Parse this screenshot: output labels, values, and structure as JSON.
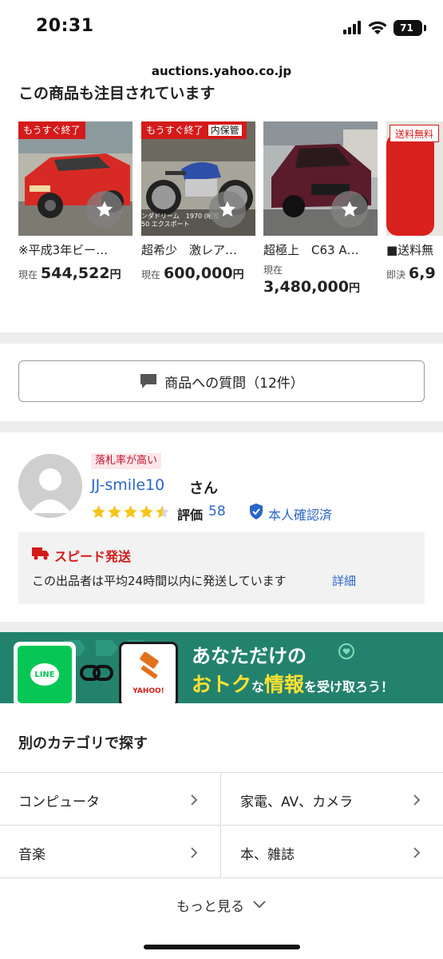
{
  "status_bar": {
    "time": "20:31",
    "battery": "71"
  },
  "url": "auctions.yahoo.co.jp",
  "related": {
    "heading": "この商品も注目されています",
    "items": [
      {
        "badge": "もうすぐ終了",
        "title": "※平成3年ビー…",
        "price_label": "現在",
        "price": "544,522",
        "unit": "円"
      },
      {
        "badge": "もうすぐ終了",
        "badge_overflow": "内保管",
        "overlay_text": "ンダドリーム　1970 (昭和\n50 エクスポート",
        "title": "超希少　激レア…",
        "price_label": "現在",
        "price": "600,000",
        "unit": "円"
      },
      {
        "title": "超極上　C63 A…",
        "price_label": "現在",
        "price": "3,480,000",
        "unit": "円"
      },
      {
        "badge": "送料無料",
        "title": "■送料無",
        "price_label": "即決",
        "price": "6,9"
      }
    ]
  },
  "question_button": {
    "label": "商品への質問（12件）"
  },
  "seller": {
    "tag": "落札率が高い",
    "name": "JJ-smile10",
    "honorific": "さん",
    "stars": 4.5,
    "rating_label": "評価",
    "rating_value": "58",
    "verified": "本人確認済",
    "shipping_title": "スピード発送",
    "shipping_desc": "この出品者は平均24時間以内に発送しています",
    "shipping_link": "詳細"
  },
  "banner": {
    "line_logo": "LINE",
    "yahoo_logo": "YAHOO!",
    "line1": "あなただけの",
    "line2_a": "おトク",
    "line2_b": "な",
    "line2_c": "情報",
    "line2_d": "を受け取ろう！"
  },
  "categories": {
    "heading": "別のカテゴリで探す",
    "items": [
      "コンピュータ",
      "家電、AV、カメラ",
      "音楽",
      "本、雑誌"
    ],
    "more": "もっと見る"
  },
  "colors": {
    "accent_red": "#d41a1a",
    "link_blue": "#2a66c9",
    "banner_green": "#23826d"
  }
}
